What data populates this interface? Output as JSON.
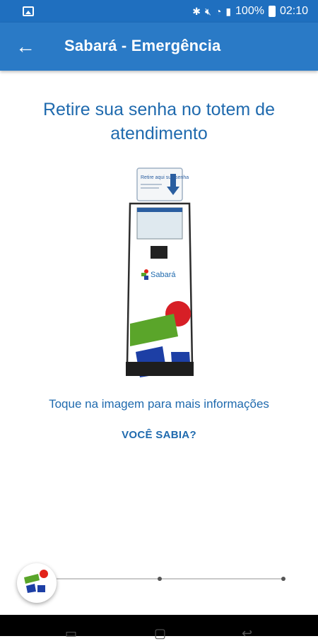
{
  "status_bar": {
    "battery": "100%",
    "time": "02:10",
    "icons": [
      "gallery-icon",
      "bluetooth-icon",
      "mute-icon",
      "wifi-icon",
      "signal-icon",
      "battery-icon"
    ]
  },
  "header": {
    "title": "Sabará - Emergência",
    "back_icon": "arrow-left-icon"
  },
  "main": {
    "headline": "Retire sua senha no totem de atendimento",
    "kiosk_sign": "Retire aqui sua senha",
    "kiosk_brand": "Sabará",
    "tap_hint": "Toque na imagem para mais informações",
    "did_you_know": "VOCÊ SABIA?"
  },
  "onboarding": {
    "current_step": 1,
    "total_steps": 3
  },
  "colors": {
    "status_bar": "#1f6fbf",
    "app_bar": "#2a7ac6",
    "accent_text": "#1f6aae"
  }
}
